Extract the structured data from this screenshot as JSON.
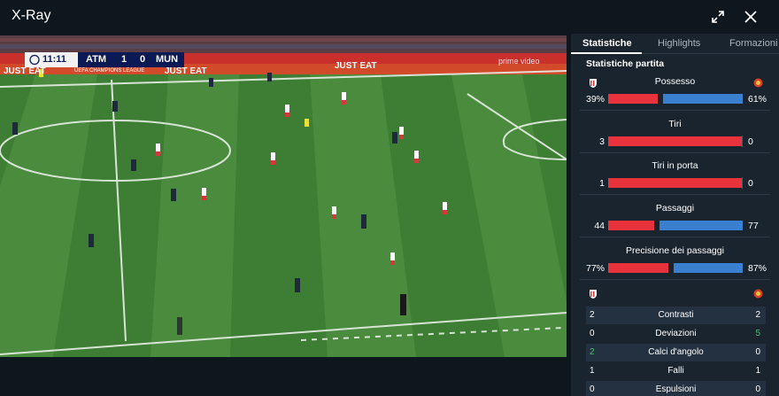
{
  "header": {
    "title": "X-Ray",
    "expand_icon": "expand-icon",
    "close_icon": "close-icon"
  },
  "scoreboard": {
    "clock": "11:11",
    "home": "ATM",
    "home_score": "1",
    "away_score": "0",
    "away": "MUN"
  },
  "video_overlay": {
    "ads_left": "JUST EAT",
    "ads_mid": "JUST EAT",
    "ads_right": "JUST EAT",
    "league": "UEFA CHAMPIONS LEAGUE",
    "watermark": "prime video"
  },
  "tabs": [
    {
      "label": "Statistiche",
      "active": true
    },
    {
      "label": "Highlights",
      "active": false
    },
    {
      "label": "Formazioni",
      "active": false
    }
  ],
  "stats": {
    "section_title": "Statistiche partita",
    "home_color": "#e8333c",
    "away_color": "#3b7fd1",
    "bars": [
      {
        "label": "Possesso",
        "home": "39%",
        "away": "61%",
        "home_frac": 0.39
      },
      {
        "label": "Tiri",
        "home": "3",
        "away": "0",
        "home_frac": 1.0
      },
      {
        "label": "Tiri in porta",
        "home": "1",
        "away": "0",
        "home_frac": 1.0
      },
      {
        "label": "Passaggi",
        "home": "44",
        "away": "77",
        "home_frac": 0.36
      },
      {
        "label": "Precisione dei passaggi",
        "home": "77%",
        "away": "87%",
        "home_frac": 0.47
      }
    ],
    "table": [
      {
        "label": "Contrasti",
        "home": "2",
        "away": "2",
        "highlight": "none"
      },
      {
        "label": "Deviazioni",
        "home": "0",
        "away": "5",
        "highlight": "away"
      },
      {
        "label": "Calci d'angolo",
        "home": "2",
        "away": "0",
        "highlight": "home"
      },
      {
        "label": "Falli",
        "home": "1",
        "away": "1",
        "highlight": "none"
      },
      {
        "label": "Espulsioni",
        "home": "0",
        "away": "0",
        "highlight": "none"
      }
    ]
  }
}
